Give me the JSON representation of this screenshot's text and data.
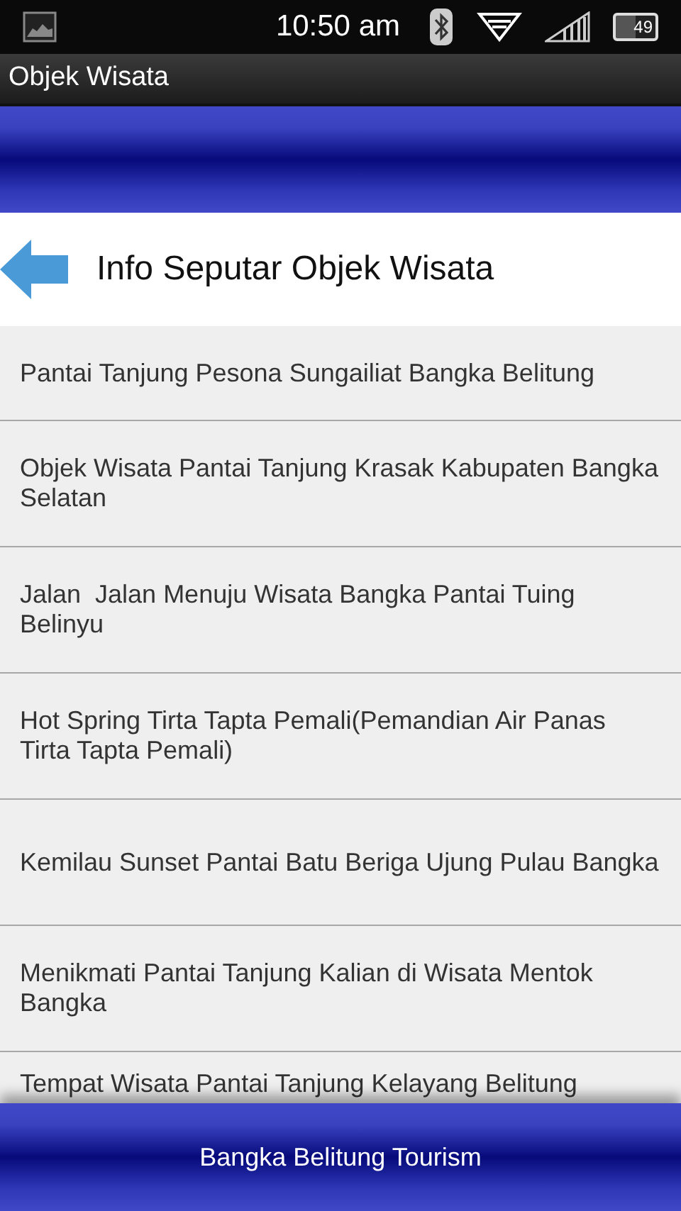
{
  "status_bar": {
    "time": "10:50 am",
    "battery": "49"
  },
  "window": {
    "title": "Objek Wisata"
  },
  "header": {
    "title": "Info Seputar Objek Wisata"
  },
  "items": [
    {
      "text": "Pantai Tanjung Pesona Sungailiat Bangka Belitung"
    },
    {
      "text": "Objek Wisata Pantai Tanjung Krasak Kabupaten Bangka Selatan"
    },
    {
      "text": "Jalan  Jalan Menuju Wisata Bangka Pantai Tuing Belinyu"
    },
    {
      "text": "Hot Spring Tirta Tapta Pemali(Pemandian Air Panas Tirta Tapta Pemali)"
    },
    {
      "text": "Kemilau Sunset Pantai Batu Beriga Ujung Pulau Bangka"
    },
    {
      "text": "Menikmati Pantai Tanjung Kalian di Wisata Mentok Bangka"
    },
    {
      "text": "Tempat Wisata Pantai Tanjung Kelayang Belitung"
    }
  ],
  "footer": {
    "text": "Bangka Belitung Tourism"
  }
}
